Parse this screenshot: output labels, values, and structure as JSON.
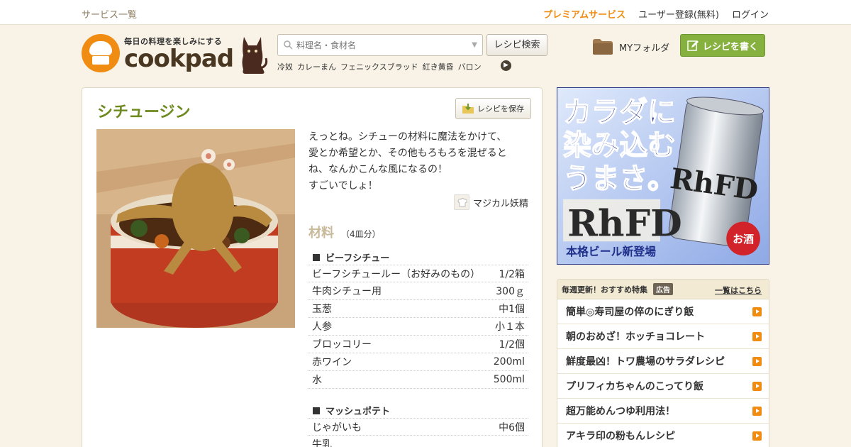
{
  "topbar": {
    "services_link": "サービス一覧",
    "premium": "プレミアムサービス",
    "register": "ユーザー登録(無料)",
    "login": "ログイン"
  },
  "brand": {
    "tagline": "毎日の料理を楽しみにする",
    "name": "cookpad",
    "accent_color": "#f08c12"
  },
  "search": {
    "placeholder": "料理名・食材名",
    "button": "レシピ検索",
    "keywords": [
      "冷奴",
      "カレーまん",
      "フェニックスブラッド",
      "紅き黄昏",
      "バロン"
    ]
  },
  "header": {
    "my_folder": "MYフォルダ",
    "write_recipe": "レシピを書く"
  },
  "recipe": {
    "title": "シチュージン",
    "save_button": "レシピを保存",
    "description": [
      "えっとね。シチューの材料に魔法をかけて、",
      "愛とか希望とか、その他もろもろを混ぜると",
      "ね、なんかこんな風になるの！",
      "すごいでしょ！"
    ],
    "author": "マジカル妖精",
    "ingredients_heading": "材料",
    "servings": "（4皿分）",
    "groups": [
      {
        "name": "ビーフシチュー",
        "items": [
          {
            "name": "ビーフシチュールー（お好みのもの）",
            "qty": "1/2箱"
          },
          {
            "name": "牛肉シチュー用",
            "qty": "300ｇ"
          },
          {
            "name": "玉葱",
            "qty": "中1個"
          },
          {
            "name": "人参",
            "qty": "小１本"
          },
          {
            "name": "ブロッコリー",
            "qty": "1/2個"
          },
          {
            "name": "赤ワイン",
            "qty": "200ml"
          },
          {
            "name": "水",
            "qty": "500ml"
          }
        ]
      },
      {
        "name": "マッシュポテト",
        "items": [
          {
            "name": "じゃがいも",
            "qty": "中6個"
          },
          {
            "name": "牛乳",
            "qty": ""
          }
        ]
      }
    ]
  },
  "ad": {
    "headline_1": "カラダに",
    "headline_2": "染み込む",
    "headline_3": "うまさ。",
    "product": "RhFD",
    "sub": "本格ビール新登場",
    "badge": "お酒"
  },
  "featured": {
    "heading": "毎週更新！おすすめ特集",
    "badge": "広告",
    "more_link": "一覧はこちら",
    "items": [
      "簡単◎寿司屋の倅のにぎり飯",
      "朝のおめざ！ホッチョコレート",
      "鮮度最凶！トワ農場のサラダレシピ",
      "プリフィカちゃんのこってり飯",
      "超万能めんつゆ利用法！",
      "アキラ印の粉もんレシピ"
    ]
  }
}
